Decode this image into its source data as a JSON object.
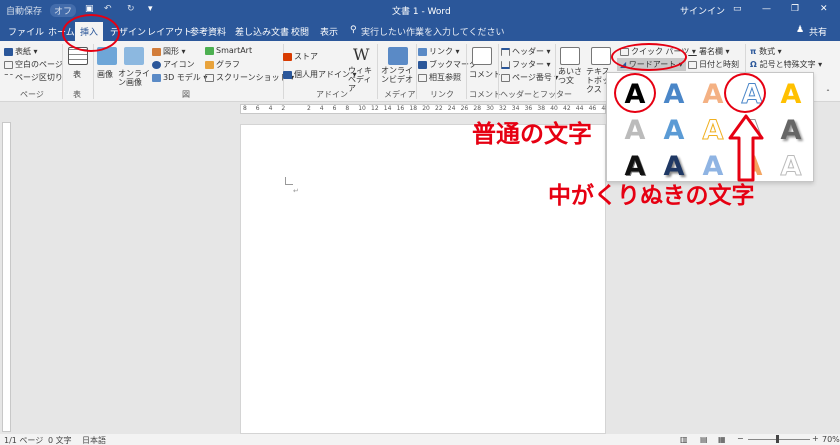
{
  "titlebar": {
    "autosave": "自動保存",
    "autosave_state": "オフ",
    "document_title": "文書 1 - Word",
    "signin": "サインイン"
  },
  "tabs": [
    "ファイル",
    "ホーム",
    "挿入",
    "デザイン",
    "レイアウト",
    "参考資料",
    "差し込み文書",
    "校閲",
    "表示"
  ],
  "tell_me": "実行したい作業を入力してください",
  "share": "共有",
  "ribbon": {
    "pages": {
      "cover": "表紙",
      "blank": "空白のページ",
      "break": "ページ区切り",
      "group": "ページ"
    },
    "tables": {
      "table": "表",
      "group": "表"
    },
    "illustrations": {
      "image": "画像",
      "online_image": "オンライン画像",
      "shapes": "図形",
      "icons": "アイコン",
      "model3d": "3D モデル",
      "smartart": "SmartArt",
      "chart": "グラフ",
      "screenshot": "スクリーンショット",
      "group": "図"
    },
    "addins": {
      "store": "ストア",
      "my_addins": "個人用アドイン",
      "wikipedia": "ウィキペディア",
      "group": "アドイン"
    },
    "media": {
      "online_video": "オンラインビデオ",
      "group": "メディア"
    },
    "links": {
      "link": "リンク",
      "bookmark": "ブックマーク",
      "crossref": "相互参照",
      "group": "リンク"
    },
    "comments": {
      "comment": "コメント",
      "group": "コメント"
    },
    "headerfooter": {
      "header": "ヘッダー",
      "footer": "フッター",
      "pagenum": "ページ番号",
      "group": "ヘッダーとフッター"
    },
    "text": {
      "greeting": "あいさつ文",
      "textbox": "テキストボックス",
      "quickparts": "クイック パーツ",
      "wordart": "ワードアート",
      "signature": "署名欄",
      "datetime": "日付と時刻"
    },
    "symbols": {
      "equation": "数式",
      "symbol": "記号と特殊文字"
    }
  },
  "ruler_numbers": [
    "8",
    "6",
    "4",
    "2",
    "",
    "2",
    "4",
    "6",
    "8",
    "10",
    "12",
    "14",
    "16",
    "18",
    "20",
    "22",
    "24",
    "26",
    "28",
    "30",
    "32",
    "34",
    "36",
    "38",
    "40",
    "42",
    "44",
    "46",
    "48"
  ],
  "wordart_gallery": [
    "A",
    "A",
    "A",
    "A",
    "A",
    "A",
    "A",
    "A",
    "A",
    "A",
    "A",
    "A",
    "A",
    "A",
    "A"
  ],
  "annotations": {
    "normal": "普通の文字",
    "hollow": "中がくりぬきの文字"
  },
  "status": {
    "page": "1/1 ページ",
    "words": "0 文字",
    "lang": "日本語",
    "zoom": "70%"
  }
}
